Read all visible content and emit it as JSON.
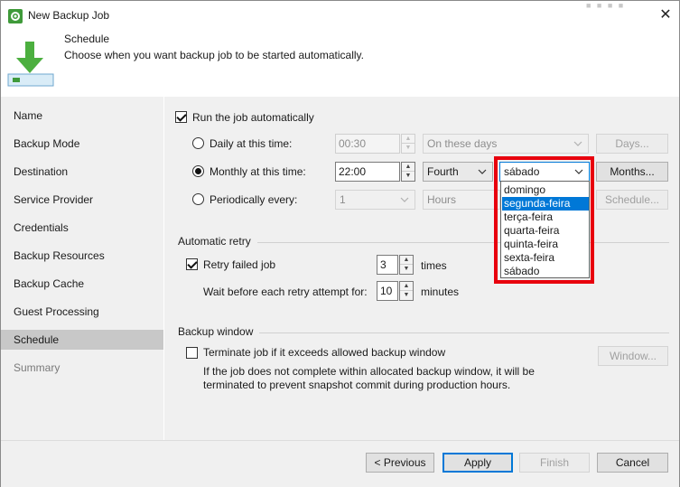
{
  "window": {
    "title": "New Backup Job",
    "close_icon": "close-icon"
  },
  "header": {
    "title": "Schedule",
    "subtitle": "Choose when you want backup job to be started automatically."
  },
  "sidebar": {
    "items": [
      {
        "label": "Name"
      },
      {
        "label": "Backup Mode"
      },
      {
        "label": "Destination"
      },
      {
        "label": "Service Provider"
      },
      {
        "label": "Credentials"
      },
      {
        "label": "Backup Resources"
      },
      {
        "label": "Backup Cache"
      },
      {
        "label": "Guest Processing"
      },
      {
        "label": "Schedule",
        "active": true
      },
      {
        "label": "Summary",
        "disabled": true
      }
    ]
  },
  "schedule": {
    "run_auto_label": "Run the job automatically",
    "run_auto_checked": true,
    "daily": {
      "label": "Daily at this time:",
      "time": "00:30",
      "days_option": "On these days",
      "days_button": "Days...",
      "selected": false
    },
    "monthly": {
      "label": "Monthly at this time:",
      "time": "22:00",
      "week": "Fourth",
      "day": "sábado",
      "months_button": "Months...",
      "selected": true
    },
    "periodically": {
      "label": "Periodically every:",
      "value": "1",
      "unit": "Hours",
      "schedule_button": "Schedule...",
      "selected": false
    },
    "day_options": [
      "domingo",
      "segunda-feira",
      "terça-feira",
      "quarta-feira",
      "quinta-feira",
      "sexta-feira",
      "sábado"
    ],
    "highlighted_option": "segunda-feira"
  },
  "retry": {
    "group_title": "Automatic retry",
    "retry_label": "Retry failed job",
    "retry_checked": true,
    "retry_count": "3",
    "times_label": "times",
    "wait_label": "Wait before each retry attempt for:",
    "wait_value": "10",
    "minutes_label": "minutes"
  },
  "window_group": {
    "group_title": "Backup window",
    "terminate_label": "Terminate job if it exceeds allowed backup window",
    "terminate_checked": false,
    "window_button": "Window...",
    "note_line1": "If the job does not complete within allocated backup window, it will be",
    "note_line2": "terminated to prevent snapshot commit during production hours."
  },
  "footer": {
    "previous": "< Previous",
    "apply": "Apply",
    "finish": "Finish",
    "cancel": "Cancel"
  },
  "colors": {
    "accent": "#0078d7",
    "highlight": "#e8000d",
    "brand_green": "#3f9a3a"
  }
}
